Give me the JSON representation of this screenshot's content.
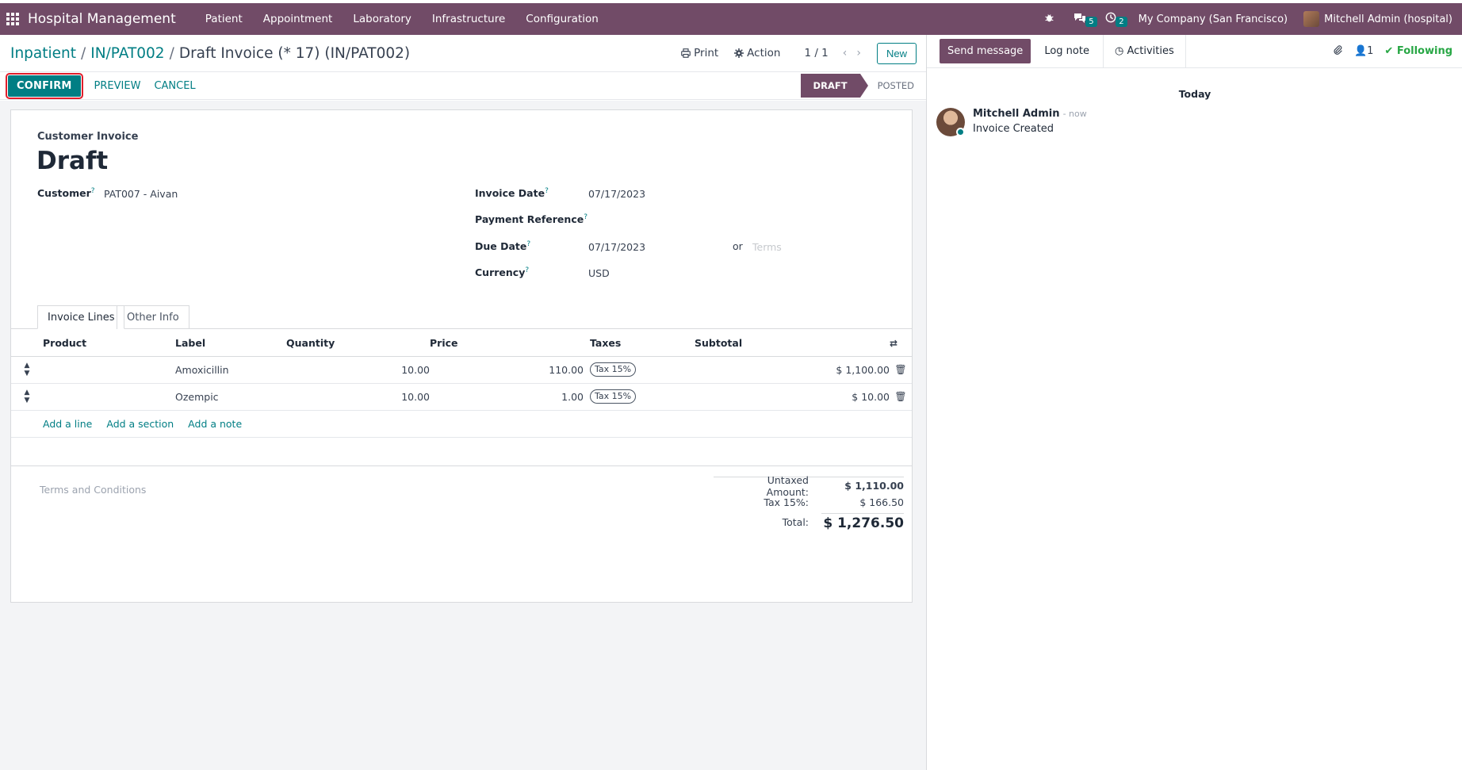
{
  "navbar": {
    "brand": "Hospital Management",
    "menu": [
      "Patient",
      "Appointment",
      "Laboratory",
      "Infrastructure",
      "Configuration"
    ],
    "messages_count": "5",
    "activities_count": "2",
    "company": "My Company (San Francisco)",
    "user": "Mitchell Admin (hospital)"
  },
  "breadcrumb": {
    "root": "Inpatient",
    "parent": "IN/PAT002",
    "current": "Draft Invoice (* 17) (IN/PAT002)"
  },
  "control": {
    "print": "Print",
    "action": "Action",
    "pager": "1 / 1",
    "new": "New"
  },
  "statusbar": {
    "confirm": "CONFIRM",
    "preview": "PREVIEW",
    "cancel": "CANCEL",
    "stage_active": "DRAFT",
    "stage_next": "POSTED"
  },
  "invoice": {
    "type": "Customer Invoice",
    "name": "Draft",
    "customer_label": "Customer",
    "customer": "PAT007 - Aivan",
    "invoice_date_label": "Invoice Date",
    "invoice_date": "07/17/2023",
    "payment_ref_label": "Payment Reference",
    "due_date_label": "Due Date",
    "due_date": "07/17/2023",
    "or": "or",
    "terms_placeholder": "Terms",
    "currency_label": "Currency",
    "currency": "USD",
    "tooltip_mark": "?"
  },
  "tabs": {
    "lines": "Invoice Lines",
    "other": "Other Info"
  },
  "table": {
    "headers": {
      "product": "Product",
      "label": "Label",
      "quantity": "Quantity",
      "price": "Price",
      "taxes": "Taxes",
      "subtotal": "Subtotal"
    },
    "rows": [
      {
        "product": "",
        "label": "Amoxicillin",
        "quantity": "10.00",
        "price": "110.00",
        "tax": "Tax 15%",
        "subtotal": "$ 1,100.00"
      },
      {
        "product": "",
        "label": "Ozempic",
        "quantity": "10.00",
        "price": "1.00",
        "tax": "Tax 15%",
        "subtotal": "$ 10.00"
      }
    ],
    "add_line": "Add a line",
    "add_section": "Add a section",
    "add_note": "Add a note"
  },
  "footer": {
    "terms": "Terms and Conditions",
    "untaxed_label": "Untaxed Amount:",
    "untaxed": "$ 1,110.00",
    "tax_label": "Tax 15%:",
    "tax": "$ 166.50",
    "total_label": "Total:",
    "total": "$ 1,276.50"
  },
  "chatter": {
    "send": "Send message",
    "log": "Log note",
    "activities": "Activities",
    "followers": "1",
    "following": "Following",
    "day": "Today",
    "author": "Mitchell Admin",
    "time": "- now",
    "body": "Invoice Created"
  },
  "colors": {
    "brand": "#714B67",
    "accent": "#017e84",
    "highlight": "#e11d2b",
    "following": "#28a745"
  }
}
